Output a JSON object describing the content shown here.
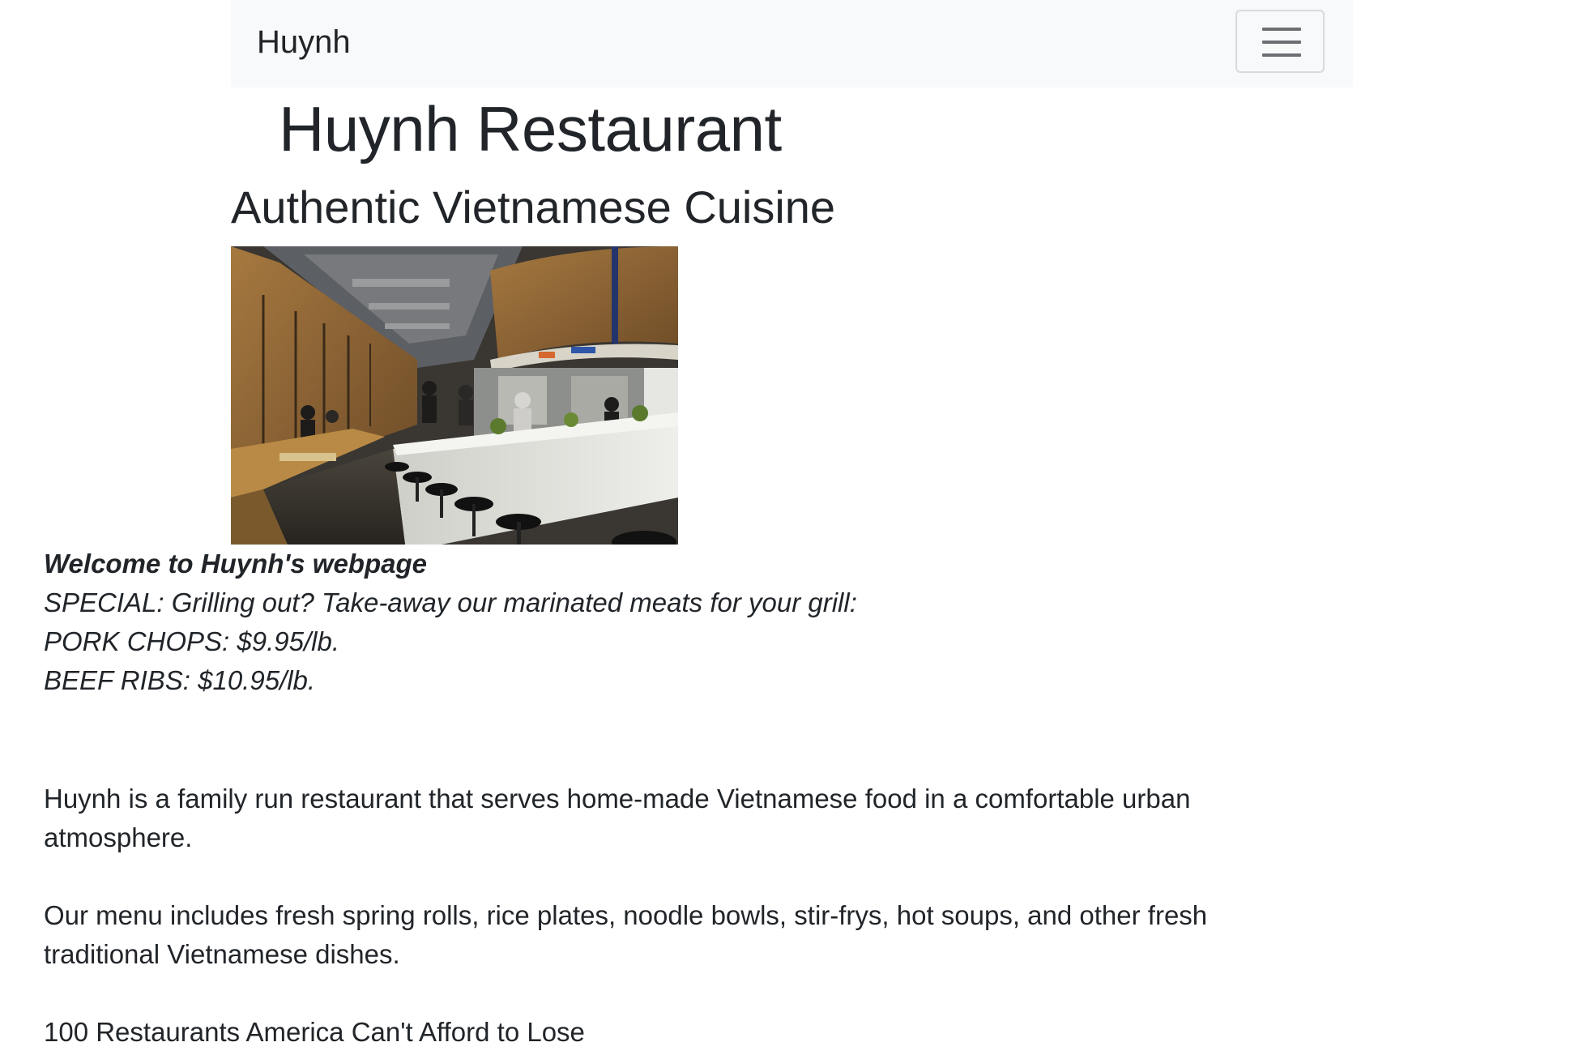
{
  "navbar": {
    "brand": "Huynh",
    "toggle_icon": "hamburger-menu-icon"
  },
  "header": {
    "title": "Huynh Restaurant",
    "subtitle": "Authentic Vietnamese Cuisine"
  },
  "photo": {
    "alt": "Interior of Huynh restaurant with bar counter, stools and booth seating"
  },
  "welcome": {
    "heading": "Welcome to Huynh's webpage",
    "special_line": "SPECIAL: Grilling out? Take-away our marinated meats for your grill:",
    "items": [
      "PORK CHOPS: $9.95/lb.",
      "BEEF RIBS: $10.95/lb."
    ]
  },
  "about": {
    "paragraph_1": "Huynh is a family run restaurant that serves home-made Vietnamese food in a comfortable urban atmosphere.",
    "paragraph_2": "Our menu includes fresh spring rolls, rice plates, noodle bowls, stir-frys, hot soups, and other fresh traditional Vietnamese dishes.",
    "paragraph_3": "100 Restaurants America Can't Afford to Lose"
  },
  "colors": {
    "navbar_bg": "#f8f9fa",
    "text": "#212529",
    "toggler_border": "#d9dadb",
    "toggler_bar": "#6c6f73"
  }
}
